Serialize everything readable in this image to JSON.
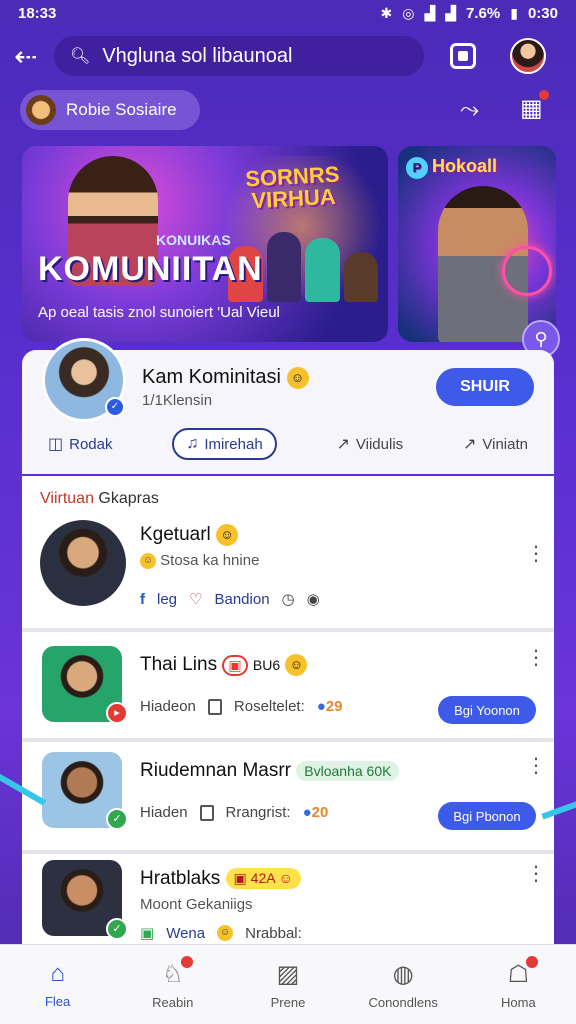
{
  "status": {
    "time": "18:33",
    "battery": "7.6%",
    "clock": "0:30"
  },
  "topbar": {
    "search_text": "Vhgluna sol libaunoal"
  },
  "chip": {
    "label": "Robie Sosiaire"
  },
  "banner": {
    "sign": "SORNRS VIRHUA",
    "small_tag": "KONUIKAS",
    "title": "KOMUNIITAN",
    "subtitle": "Ap oeal tasis znol sunoiert 'Ual Vieul"
  },
  "banner2": {
    "title": "Hokoall"
  },
  "profile": {
    "name": "Kam Kominitasi",
    "sub": "1/1Klensin",
    "follow_label": "SHUIR",
    "actions": [
      "Rodak",
      "Imirehah",
      "Viidulis",
      "Viniatn"
    ]
  },
  "feed": {
    "header_accent": "Viirtuan",
    "header_rest": " Gkapras",
    "posts": [
      {
        "title": "Kgetuarl",
        "sub": "Stosa ka hnine",
        "meta": [
          "leg",
          "Bandion"
        ]
      },
      {
        "title": "Thai Lins",
        "tag": "BU6",
        "meta_left": "Hiadeon",
        "meta_mid": "Roseltelet:",
        "count": "29",
        "button": "Bgi Yoonon"
      },
      {
        "title": "Riudemnan Masrr",
        "tag": "Bvloanha 60K",
        "meta_left": "Hiaden",
        "meta_mid": "Rrangrist:",
        "count": "20",
        "button": "Bgi Pbonon"
      },
      {
        "title": "Hratblaks",
        "tag": "42A",
        "sub": "Moont Gekaniigs",
        "meta": [
          "Wena",
          "Nrabbal:"
        ]
      }
    ]
  },
  "nav": [
    "Flea",
    "Reabin",
    "Prene",
    "Conondlens",
    "Homa"
  ]
}
